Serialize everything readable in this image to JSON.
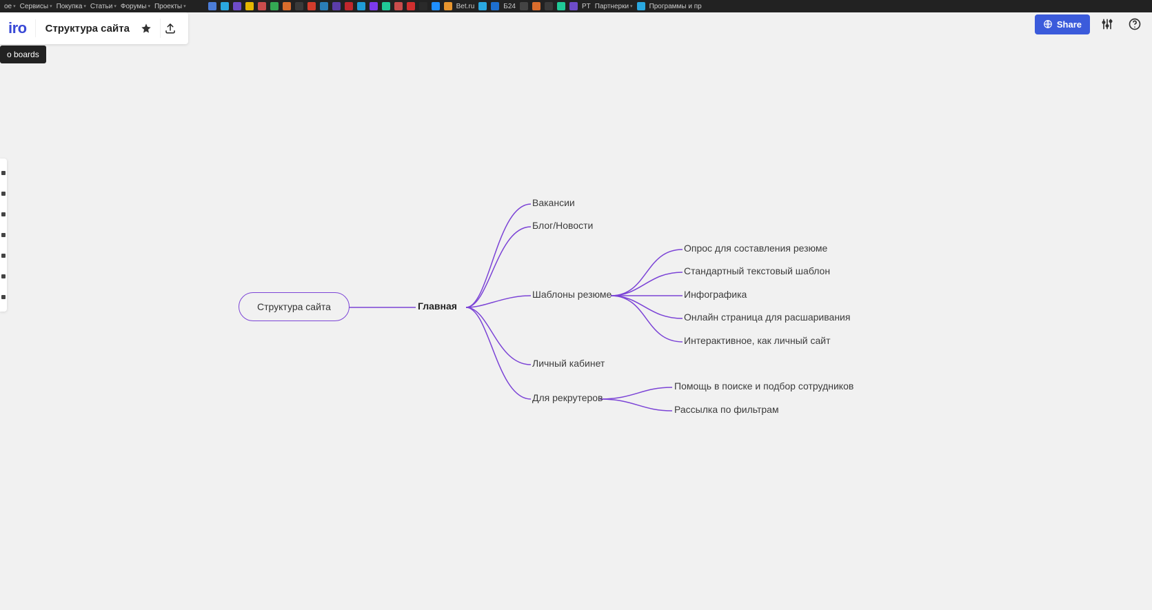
{
  "browser": {
    "bookmarks_text": [
      "ое",
      "Сервисы",
      "Покупка",
      "Статьи",
      "Форумы",
      "Проекты"
    ],
    "bookmarks_right": [
      "Bet.ru",
      "Б24",
      "PT",
      "Партнерки",
      "Программы и пр"
    ]
  },
  "app": {
    "logo": "miro",
    "logo_visible": "iro",
    "board_title": "Структура сайта",
    "tooltip": "o boards",
    "share_label": "Share"
  },
  "mindmap": {
    "root": "Структура сайта",
    "main": "Главная",
    "level2": [
      "Вакансии",
      "Блог/Новости",
      "Шаблоны резюме",
      "Личный кабинет",
      "Для рекрутеров"
    ],
    "templates_children": [
      "Опрос для составления резюме",
      "Стандартный текстовый шаблон",
      "Инфографика",
      "Онлайн страница для расшаривания",
      "Интерактивное, как личный сайт"
    ],
    "recruiters_children": [
      "Помощь в поиске и подбор сотрудников",
      "Рассылка по фильтрам"
    ]
  },
  "colors": {
    "edge": "#7b43d6"
  }
}
